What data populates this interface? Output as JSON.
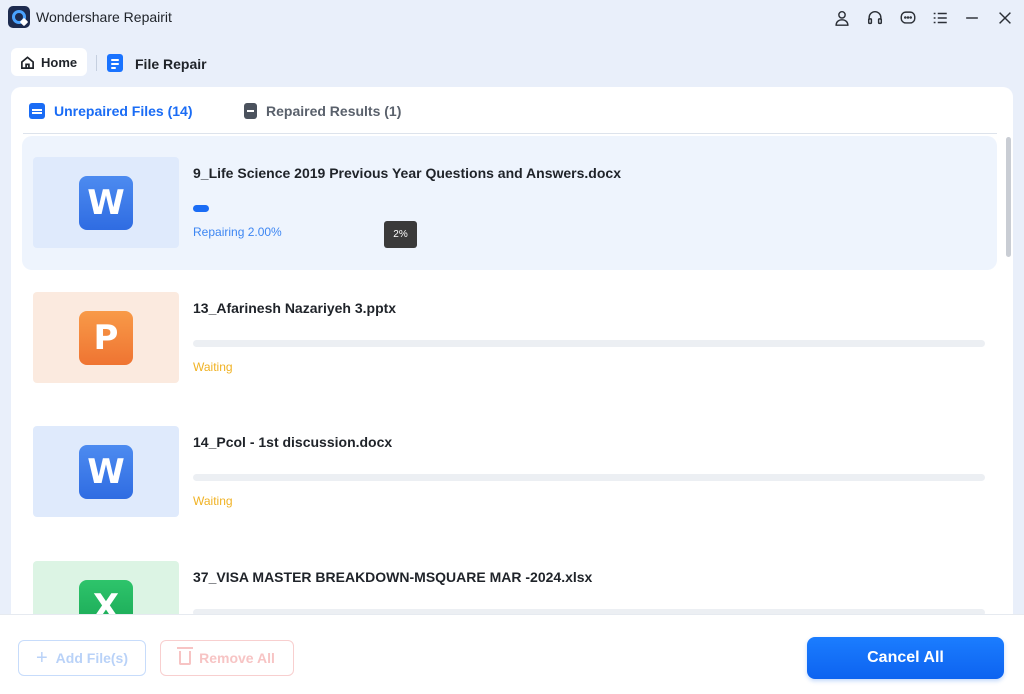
{
  "window": {
    "title": "Wondershare Repairit"
  },
  "titlebar_icons": [
    "user-icon",
    "headset-icon",
    "chat-icon",
    "menu-icon",
    "minimize-icon",
    "close-icon"
  ],
  "breadcrumb": {
    "home_label": "Home",
    "current_label": "File Repair"
  },
  "tabs": [
    {
      "label": "Unrepaired Files (14)",
      "active": true
    },
    {
      "label": "Repaired Results (1)",
      "active": false
    }
  ],
  "files": [
    {
      "name": "9_Life Science 2019 Previous Year Questions and Answers.docx",
      "type": "word",
      "badge": "W",
      "status": "Repairing 2.00%",
      "progress": 2.0,
      "tooltip": "2%"
    },
    {
      "name": "13_Afarinesh Nazariyeh 3.pptx",
      "type": "ppt",
      "badge": "P",
      "status": "Waiting",
      "progress": 0
    },
    {
      "name": "14_Pcol - 1st discussion.docx",
      "type": "word",
      "badge": "W",
      "status": "Waiting",
      "progress": 0
    },
    {
      "name": "37_VISA MASTER BREAKDOWN-MSQUARE MAR -2024.xlsx",
      "type": "excel",
      "badge": "X",
      "status": "",
      "progress": 0
    }
  ],
  "footer": {
    "add_label": "Add File(s)",
    "remove_label": "Remove All",
    "cancel_label": "Cancel All"
  },
  "colors": {
    "accent": "#1a6cf5",
    "waiting": "#f0b224",
    "repairing": "#3d86f2"
  }
}
